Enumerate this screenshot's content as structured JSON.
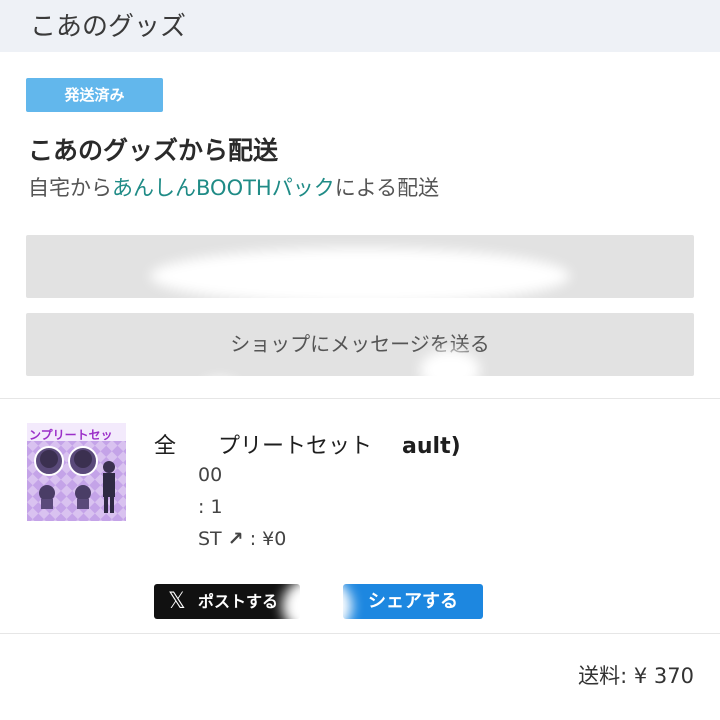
{
  "header": {
    "title": "こあのグッズ"
  },
  "order": {
    "status_badge": "発送済み",
    "ship_title": "こあのグッズから配送",
    "ship_sub_prefix": "自宅から",
    "ship_sub_link": "あんしんBOOTHパック",
    "ship_sub_suffix": "による配送",
    "message_button": "ショップにメッセージを送る"
  },
  "item": {
    "thumb_text": "ンプリートセッ",
    "name_a": "全",
    "name_b": "プリートセット",
    "name_c": "ault)",
    "price_partial": "00",
    "qty_partial": ": 1",
    "boost_partial": "ST",
    "boost_value": ": ¥0"
  },
  "share": {
    "post_label": "ポストする",
    "share_label": "シェアする"
  },
  "footer": {
    "shipping_fee": "送料: ¥ 370"
  },
  "colors": {
    "badge": "#62b7ec",
    "link": "#1f8b86",
    "share": "#1d87e0",
    "header_bg": "#eef1f6"
  }
}
